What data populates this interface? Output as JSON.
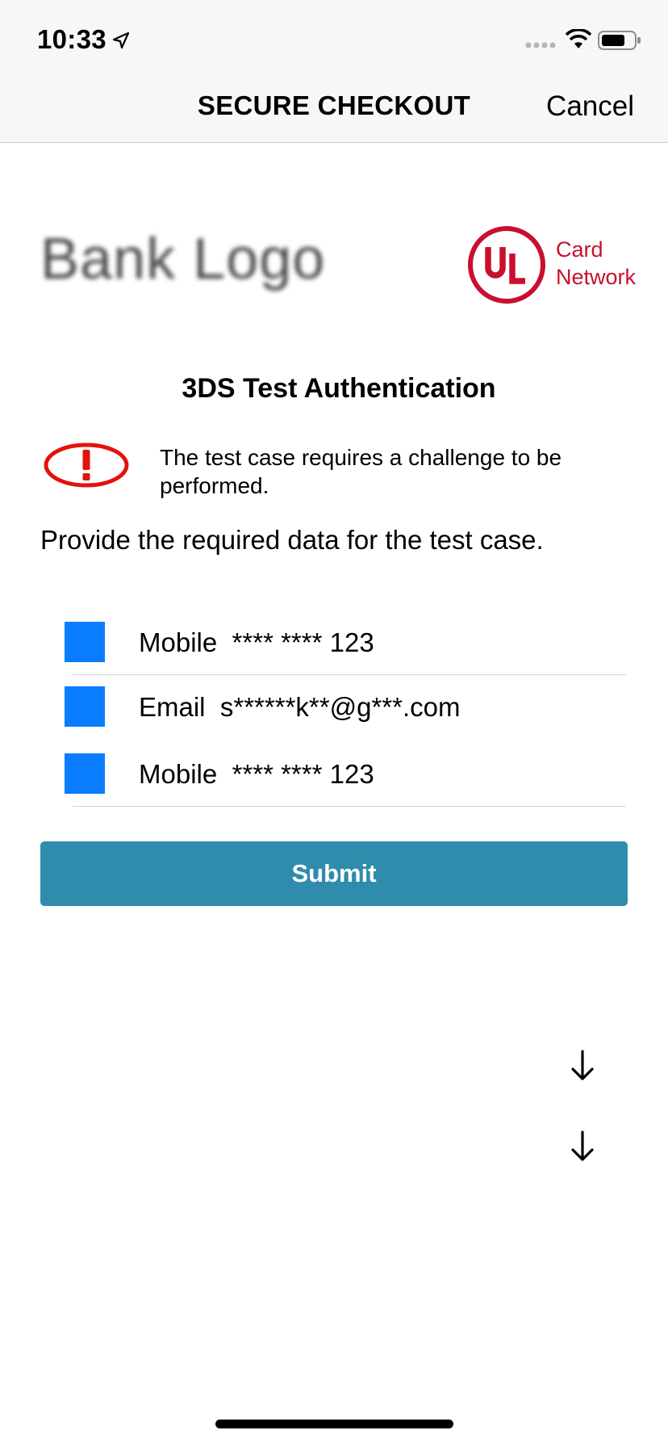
{
  "status_bar": {
    "time": "10:33",
    "icons": [
      "location-arrow-icon",
      "cellular-signal-icon",
      "wifi-icon",
      "battery-icon"
    ]
  },
  "nav": {
    "title": "SECURE CHECKOUT",
    "cancel_label": "Cancel"
  },
  "logos": {
    "bank_logo_text": "Bank Logo",
    "network_logo_mark": "UL",
    "network_name_line1": "Card",
    "network_name_line2": "Network"
  },
  "challenge": {
    "title": "3DS Test Authentication",
    "info_text": "The test case requires a challenge to be performed.",
    "instruction": "Provide the required data for the test case.",
    "options": [
      {
        "label": "Mobile  **** **** 123"
      },
      {
        "label": "Email  s******k**@g***.com"
      },
      {
        "label": "Mobile  **** **** 123"
      }
    ],
    "submit_label": "Submit"
  },
  "colors": {
    "accent": "#2f8cac",
    "checkbox": "#0a7cff",
    "network_red": "#c8102e",
    "warning_red": "#e3120b"
  }
}
